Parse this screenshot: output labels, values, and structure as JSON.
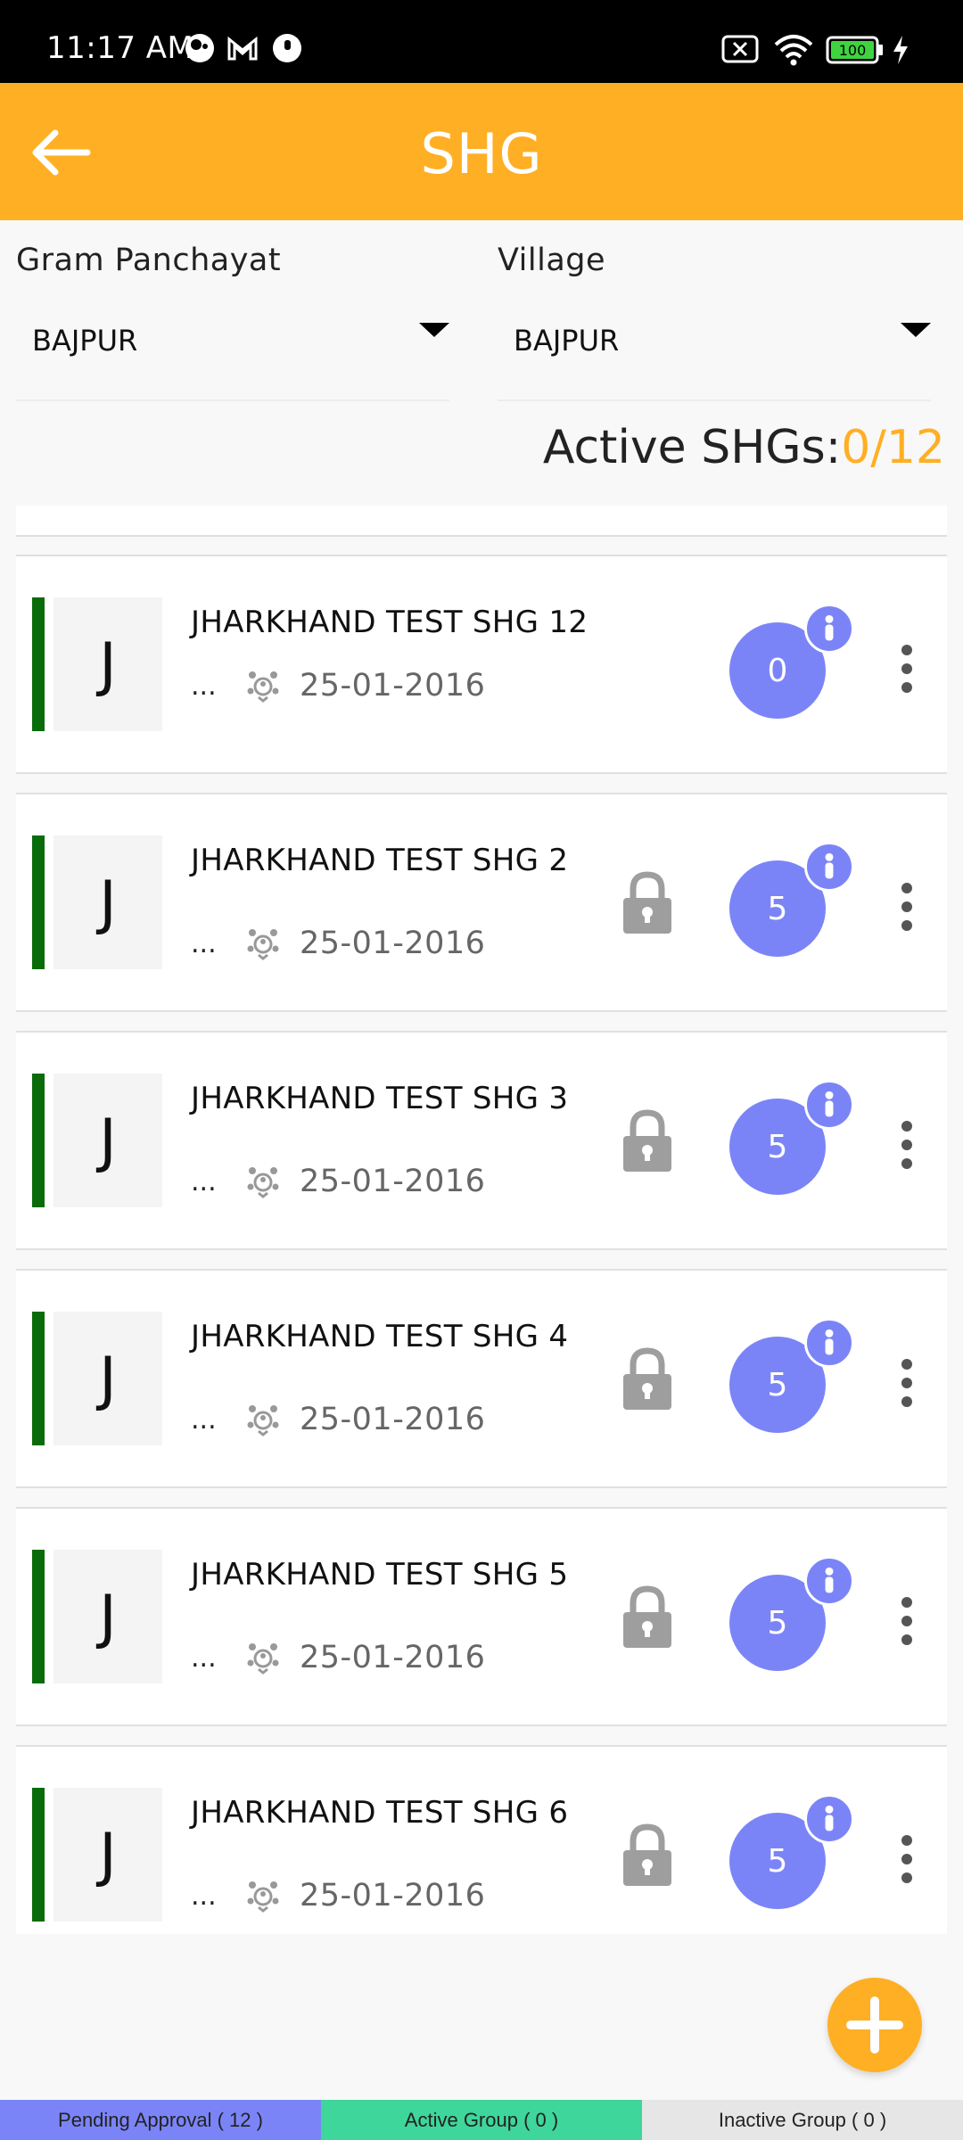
{
  "status_bar": {
    "time": "11:17 AM",
    "battery": "100"
  },
  "app_bar": {
    "title": "SHG"
  },
  "filters": {
    "gram_panchayat_label": "Gram Panchayat",
    "gram_panchayat_value": "BAJPUR",
    "village_label": "Village",
    "village_value": "BAJPUR"
  },
  "active_shgs": {
    "label": "Active SHGs:",
    "count": "0/12"
  },
  "shg_list": [
    {
      "initial": "J",
      "name": "JHARKHAND TEST SHG 12",
      "dots": "...",
      "date": "25-01-2016",
      "members": "0",
      "locked": false
    },
    {
      "initial": "J",
      "name": "JHARKHAND TEST SHG 2",
      "dots": "...",
      "date": "25-01-2016",
      "members": "5",
      "locked": true
    },
    {
      "initial": "J",
      "name": "JHARKHAND TEST SHG 3",
      "dots": "...",
      "date": "25-01-2016",
      "members": "5",
      "locked": true
    },
    {
      "initial": "J",
      "name": "JHARKHAND TEST SHG 4",
      "dots": "...",
      "date": "25-01-2016",
      "members": "5",
      "locked": true
    },
    {
      "initial": "J",
      "name": "JHARKHAND TEST SHG 5",
      "dots": "...",
      "date": "25-01-2016",
      "members": "5",
      "locked": true
    },
    {
      "initial": "J",
      "name": "JHARKHAND TEST SHG 6",
      "dots": "...",
      "date": "25-01-2016",
      "members": "5",
      "locked": true
    }
  ],
  "bottom_tabs": {
    "pending": "Pending Approval ( 12 )",
    "active": "Active Group ( 0 )",
    "inactive": "Inactive Group ( 0 )"
  },
  "colors": {
    "accent": "#FFAF24",
    "member_circle": "#7B84F7",
    "status_bar_green": "#0a6b0a",
    "active_tab": "#3ED69A"
  }
}
